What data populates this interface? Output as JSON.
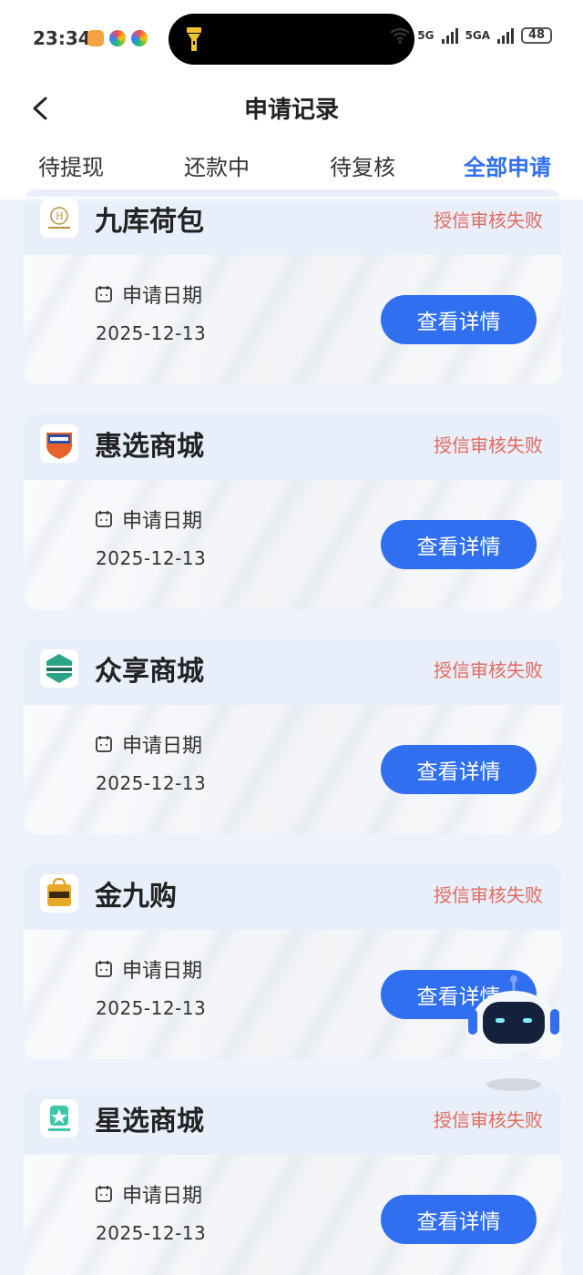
{
  "status_bar": {
    "time": "23:34",
    "network_1": "5G",
    "network_2": "5GA",
    "battery": "48"
  },
  "header": {
    "title": "申请记录",
    "back_icon": "chevron-left-icon"
  },
  "tabs": [
    {
      "label": "待提现",
      "active": false
    },
    {
      "label": "还款中",
      "active": false
    },
    {
      "label": "待复核",
      "active": false
    },
    {
      "label": "全部申请",
      "active": true
    }
  ],
  "records": [
    {
      "name": "九库荷包",
      "status": "授信审核失败",
      "date_label": "申请日期",
      "date": "2025-12-13",
      "button": "查看详情"
    },
    {
      "name": "惠选商城",
      "status": "授信审核失败",
      "date_label": "申请日期",
      "date": "2025-12-13",
      "button": "查看详情"
    },
    {
      "name": "众享商城",
      "status": "授信审核失败",
      "date_label": "申请日期",
      "date": "2025-12-13",
      "button": "查看详情"
    },
    {
      "name": "金九购",
      "status": "授信审核失败",
      "date_label": "申请日期",
      "date": "2025-12-13",
      "button": "查看详情"
    },
    {
      "name": "星选商城",
      "status": "授信审核失败",
      "date_label": "申请日期",
      "date": "2025-12-13",
      "button": "查看详情"
    }
  ],
  "colors": {
    "accent": "#2f6ff0",
    "fail_status": "#e36b5d",
    "card_header": "#e8eefa"
  }
}
